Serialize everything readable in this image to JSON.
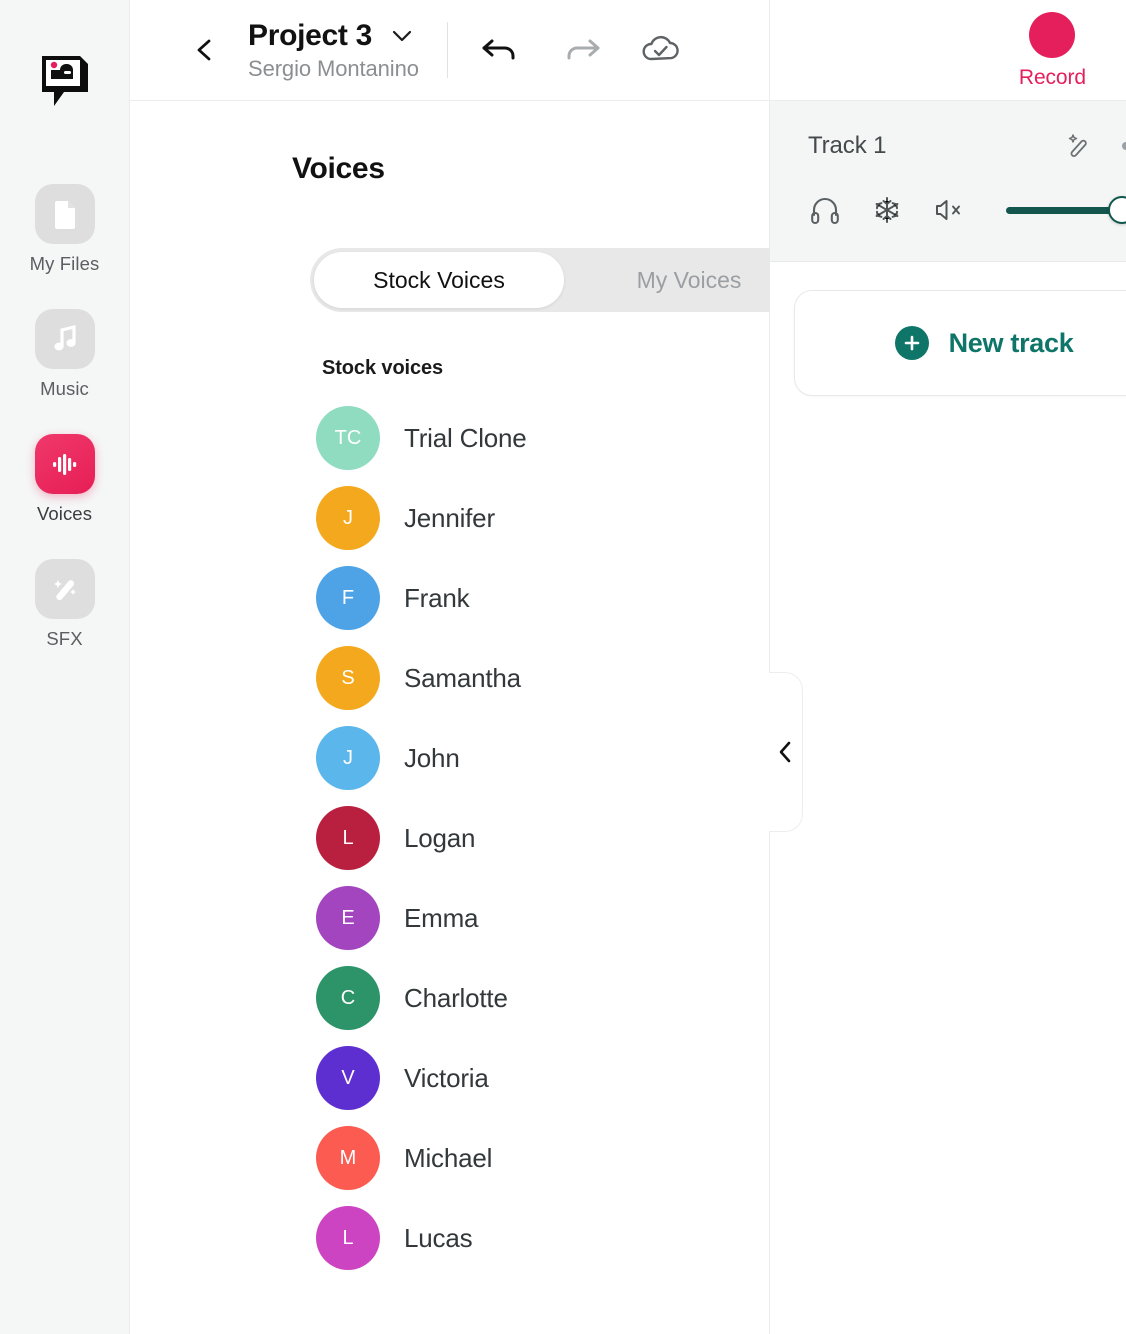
{
  "rail": {
    "logo_icon": "podcastle-speech-bubble-logo",
    "items": [
      {
        "label": "My Files",
        "icon": "file-icon",
        "active": false
      },
      {
        "label": "Music",
        "icon": "music-note-icon",
        "active": false
      },
      {
        "label": "Voices",
        "icon": "waveform-icon",
        "active": true
      },
      {
        "label": "SFX",
        "icon": "magic-wand-sparkle-icon",
        "active": false
      }
    ]
  },
  "header": {
    "back_icon": "chevron-left-icon",
    "project_title": "Project 3",
    "project_owner": "Sergio Montanino",
    "caret_icon": "chevron-down-icon",
    "undo_icon": "undo-arrow-icon",
    "redo_icon": "redo-arrow-icon",
    "cloud_icon": "cloud-check-icon",
    "record_label": "Record",
    "record_color": "#e51f5c"
  },
  "panel": {
    "title": "Voices",
    "tabs": [
      {
        "label": "Stock Voices",
        "active": true
      },
      {
        "label": "My Voices",
        "active": false
      }
    ],
    "list_heading": "Stock voices",
    "voices": [
      {
        "name": "Trial Clone",
        "initials": "TC",
        "color": "#8fdcc0"
      },
      {
        "name": "Jennifer",
        "initials": "J",
        "color": "#f4a81d"
      },
      {
        "name": "Frank",
        "initials": "F",
        "color": "#4ea3e6"
      },
      {
        "name": "Samantha",
        "initials": "S",
        "color": "#f4a81d"
      },
      {
        "name": "John",
        "initials": "J",
        "color": "#5bb6ec"
      },
      {
        "name": "Logan",
        "initials": "L",
        "color": "#b9203f"
      },
      {
        "name": "Emma",
        "initials": "E",
        "color": "#a345bf"
      },
      {
        "name": "Charlotte",
        "initials": "C",
        "color": "#2c9468"
      },
      {
        "name": "Victoria",
        "initials": "V",
        "color": "#5e2fd0"
      },
      {
        "name": "Michael",
        "initials": "M",
        "color": "#fb5b50"
      },
      {
        "name": "Lucas",
        "initials": "L",
        "color": "#cc44c2"
      }
    ],
    "scrollbar_name": "voice-list-scrollbar"
  },
  "right": {
    "collapse_icon": "collapse-panel-icon",
    "panel_handle_icon": "chevron-left-icon",
    "track": {
      "name": "Track 1",
      "enhance_icon": "magic-wand-icon",
      "more_icon": "more-options-icon",
      "solo_icon": "headphones-icon",
      "freeze_icon": "snowflake-icon",
      "mute_icon": "speaker-mute-icon",
      "volume_percent": 75
    },
    "new_track_label": "New track",
    "accent_color": "#0e7568"
  }
}
